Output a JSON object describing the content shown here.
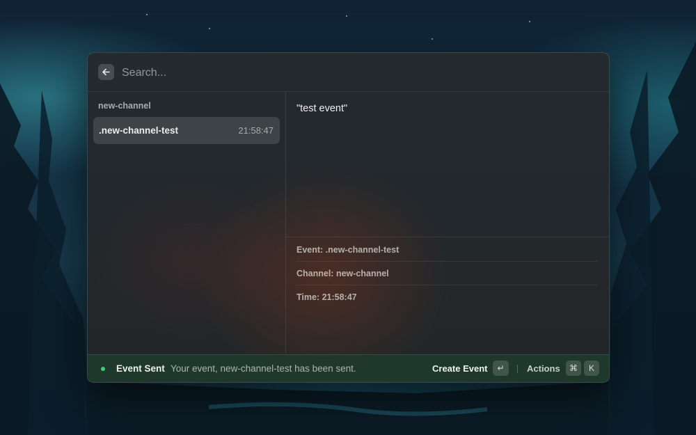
{
  "search": {
    "placeholder": "Search..."
  },
  "list": {
    "section_title": "new-channel",
    "items": [
      {
        "title": ".new-channel-test",
        "time": "21:58:47"
      }
    ]
  },
  "detail": {
    "content": "\"test event\"",
    "metadata": [
      {
        "text": "Event: .new-channel-test"
      },
      {
        "text": "Channel: new-channel"
      },
      {
        "text": "Time: 21:58:47"
      }
    ]
  },
  "footer": {
    "toast_title": "Event Sent",
    "toast_message": "Your event, new-channel-test has been sent.",
    "primary_action": "Create Event",
    "primary_key": "↵",
    "actions_label": "Actions",
    "actions_keys": [
      "⌘",
      "K"
    ]
  },
  "icons": {
    "back": "arrow-left-icon",
    "toast": "success-dot-icon"
  },
  "colors": {
    "success": "#3fcf73"
  }
}
